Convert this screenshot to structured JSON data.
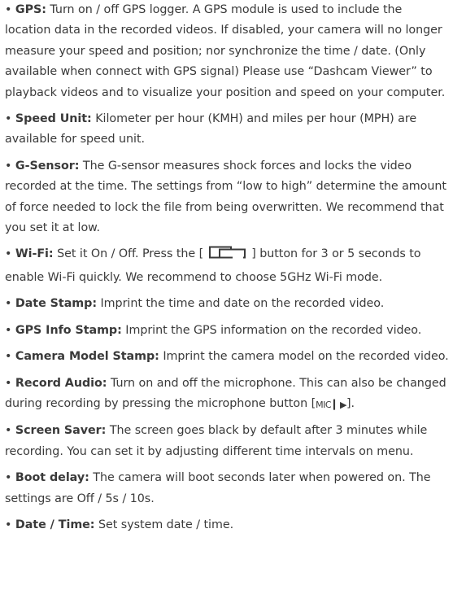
{
  "settings": [
    {
      "term": "GPS:",
      "text": "Turn on / off GPS logger. A GPS module is used to include the location data in the recorded videos. If disabled, your camera will no longer measure your speed and position; nor synchronize the time / date. (Only available when connect with GPS signal) Please use “Dashcam Viewer” to playback videos and to visualize your position and speed on your computer."
    },
    {
      "term": "Speed Unit:",
      "text": "Kilometer per hour (KMH) and miles per hour (MPH) are available for speed unit."
    },
    {
      "term": "G-Sensor:",
      "text": "The G-sensor measures shock forces and locks the video recorded at the time. The settings from “low to high” determine the amount of force needed to lock the file from being overwritten. We recommend that you set it at low."
    },
    {
      "term": "Wi-Fi:",
      "text_before": "Set it On / Off. Press the [",
      "icon": "mode-button-icon",
      "text_after": "] button for 3 or 5 seconds to enable Wi-Fi quickly. We recommend to choose 5GHz Wi-Fi mode."
    },
    {
      "term": "Date Stamp:",
      "text": "Imprint the time and date on the recorded video."
    },
    {
      "term": "GPS Info Stamp:",
      "text": "Imprint the GPS information on the recorded video."
    },
    {
      "term": "Camera Model Stamp:",
      "text": "Imprint the camera model on the recorded video."
    },
    {
      "term": "Record Audio:",
      "text_before": "Turn on and off the microphone. This can also be changed during recording by pressing the microphone button [",
      "icon": "mic-button-icon",
      "icon_label": "MIC ▎▶",
      "text_after": "]."
    },
    {
      "term": "Screen Saver:",
      "text": "The screen goes black by default after 3 minutes while recording. You can set it by adjusting different time intervals on menu."
    },
    {
      "term": "Boot delay:",
      "text": "The camera will boot seconds later when powered on. The settings are Off / 5s / 10s."
    },
    {
      "term": "Date / Time:",
      "text": "Set system date / time."
    }
  ]
}
